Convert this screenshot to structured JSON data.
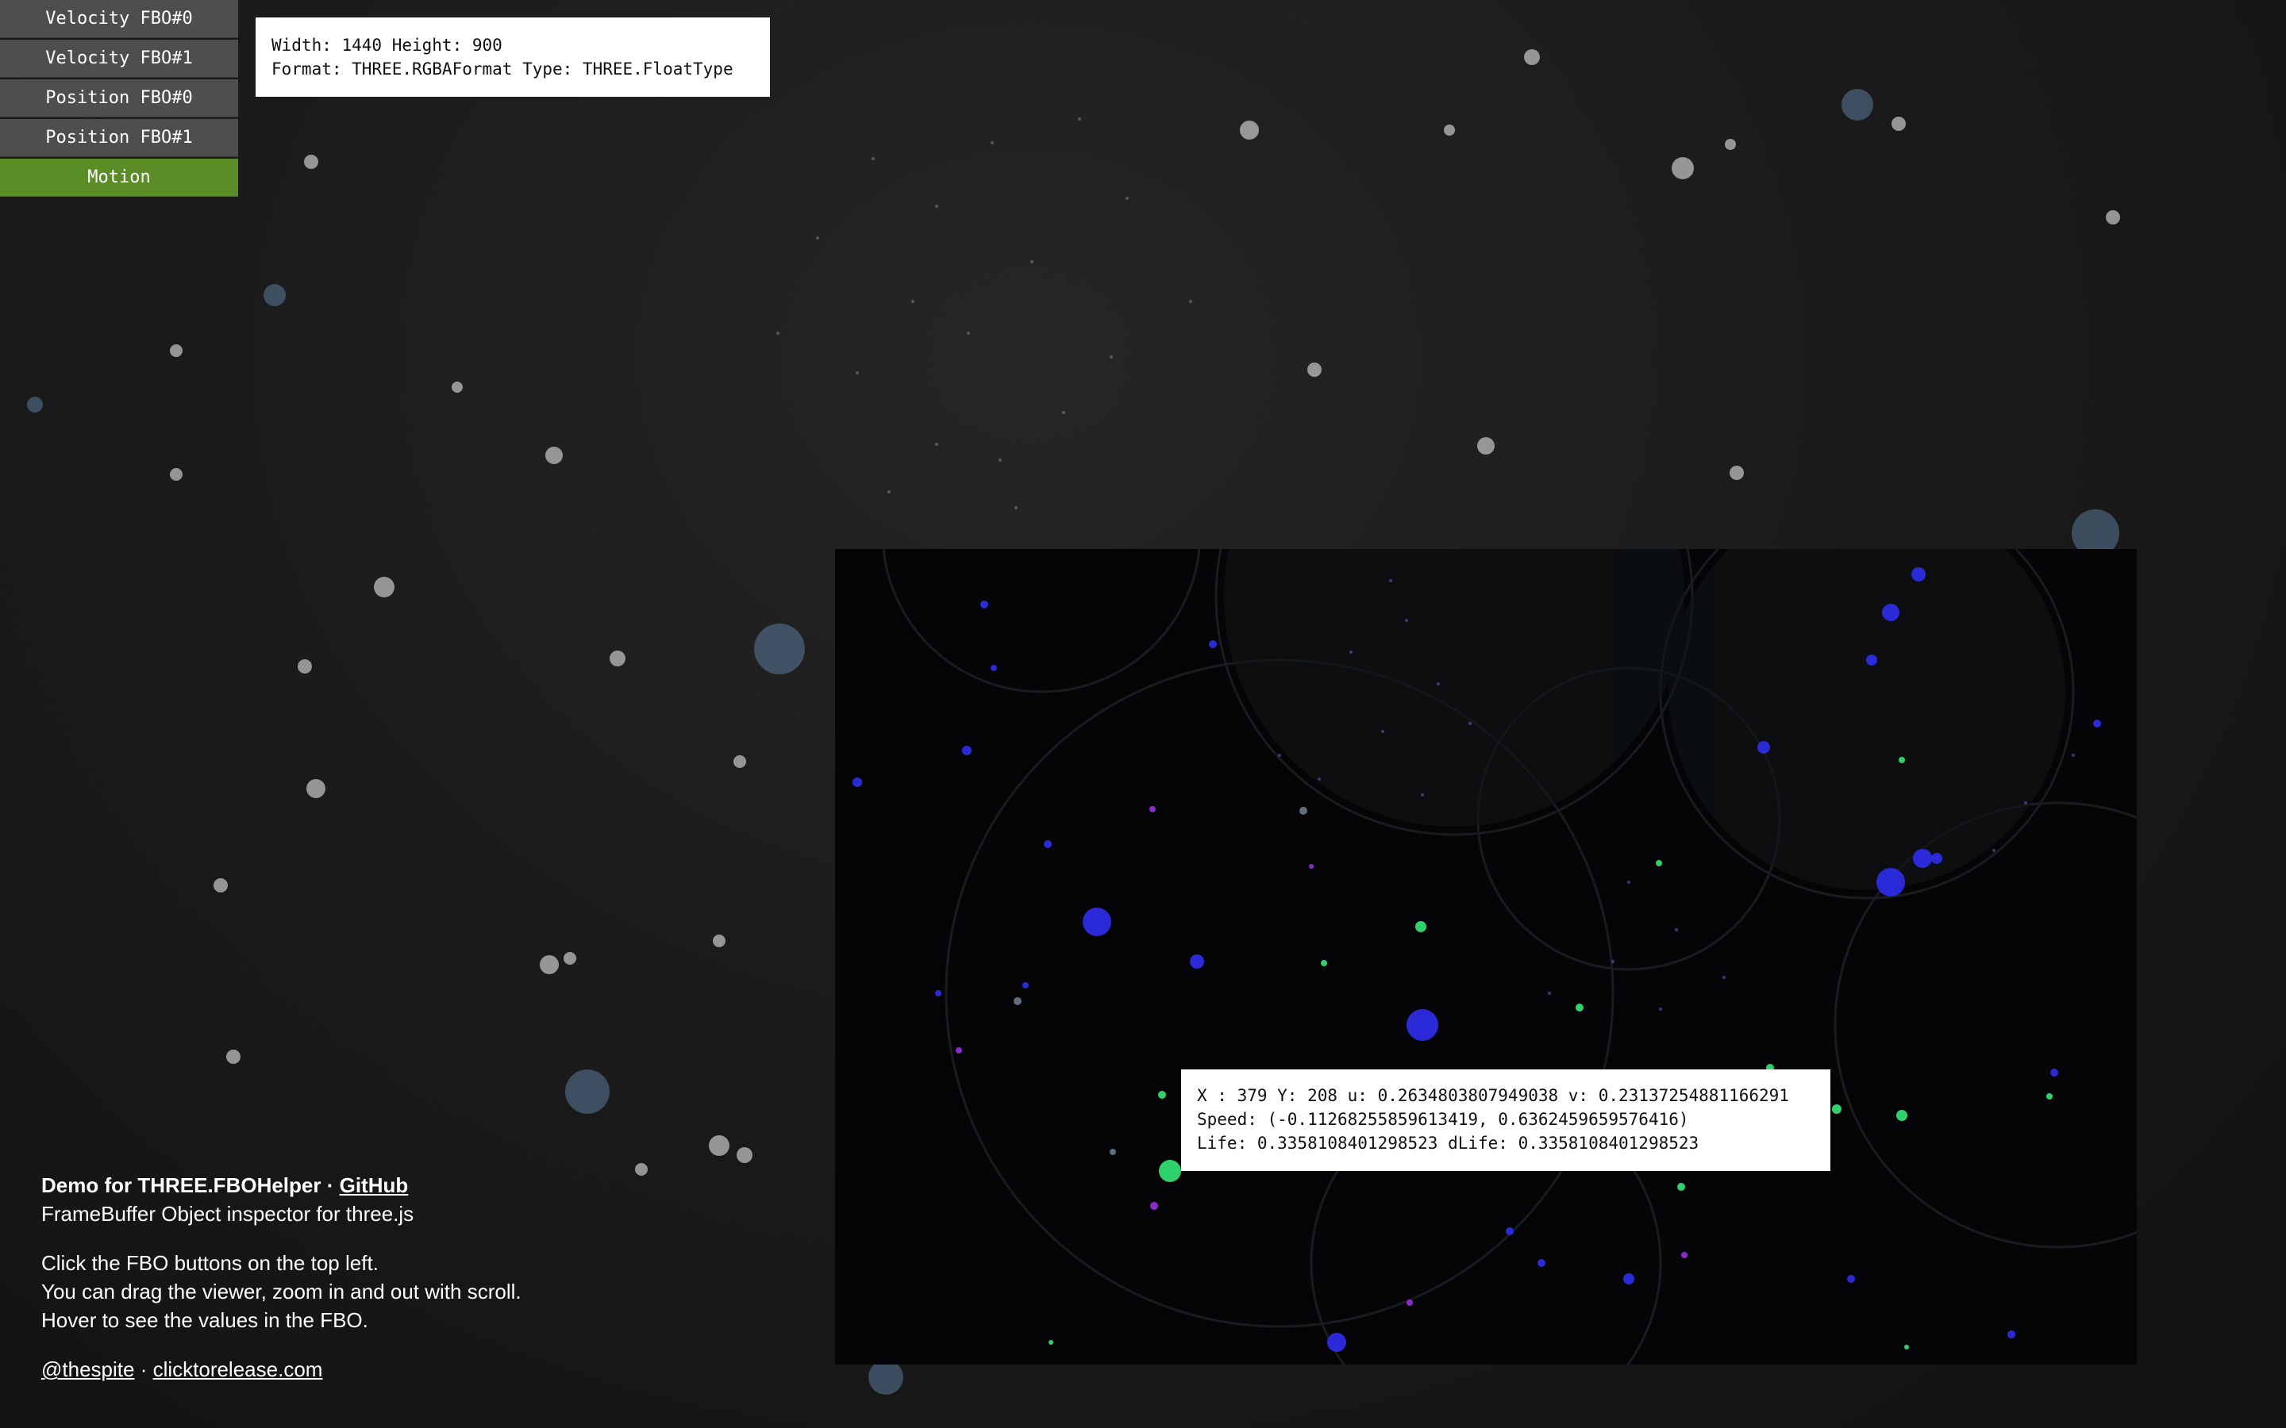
{
  "fbo_buttons": [
    {
      "label": "Velocity FBO#0",
      "active": false
    },
    {
      "label": "Velocity FBO#1",
      "active": false
    },
    {
      "label": "Position FBO#0",
      "active": false
    },
    {
      "label": "Position FBO#1",
      "active": false
    },
    {
      "label": "Motion",
      "active": true
    }
  ],
  "info": {
    "line1": "Width: 1440 Height: 900",
    "line2": "Format: THREE.RGBAFormat Type: THREE.FloatType"
  },
  "tooltip": {
    "line1": "X : 379 Y: 208 u: 0.2634803807949038 v: 0.23137254881166291",
    "line2": "Speed: (-0.11268255859613419, 0.6362459659576416)",
    "line3": "Life: 0.3358108401298523 dLife: 0.3358108401298523"
  },
  "demo": {
    "title": "Demo for THREE.FBOHelper",
    "separator": " · ",
    "github_link": "GitHub",
    "subtitle": "FrameBuffer Object inspector for three.js",
    "instructions": [
      "Click the FBO buttons on the top left.",
      "You can drag the viewer, zoom in and out with scroll.",
      "Hover to see the values in the FBO."
    ],
    "author_link": "@thespite",
    "site_link": "clicktorelease.com"
  },
  "colors": {
    "active_button": "#5b8d27",
    "button": "#4e4e4e",
    "background": "#161616",
    "viewer_bg": "#050507"
  }
}
